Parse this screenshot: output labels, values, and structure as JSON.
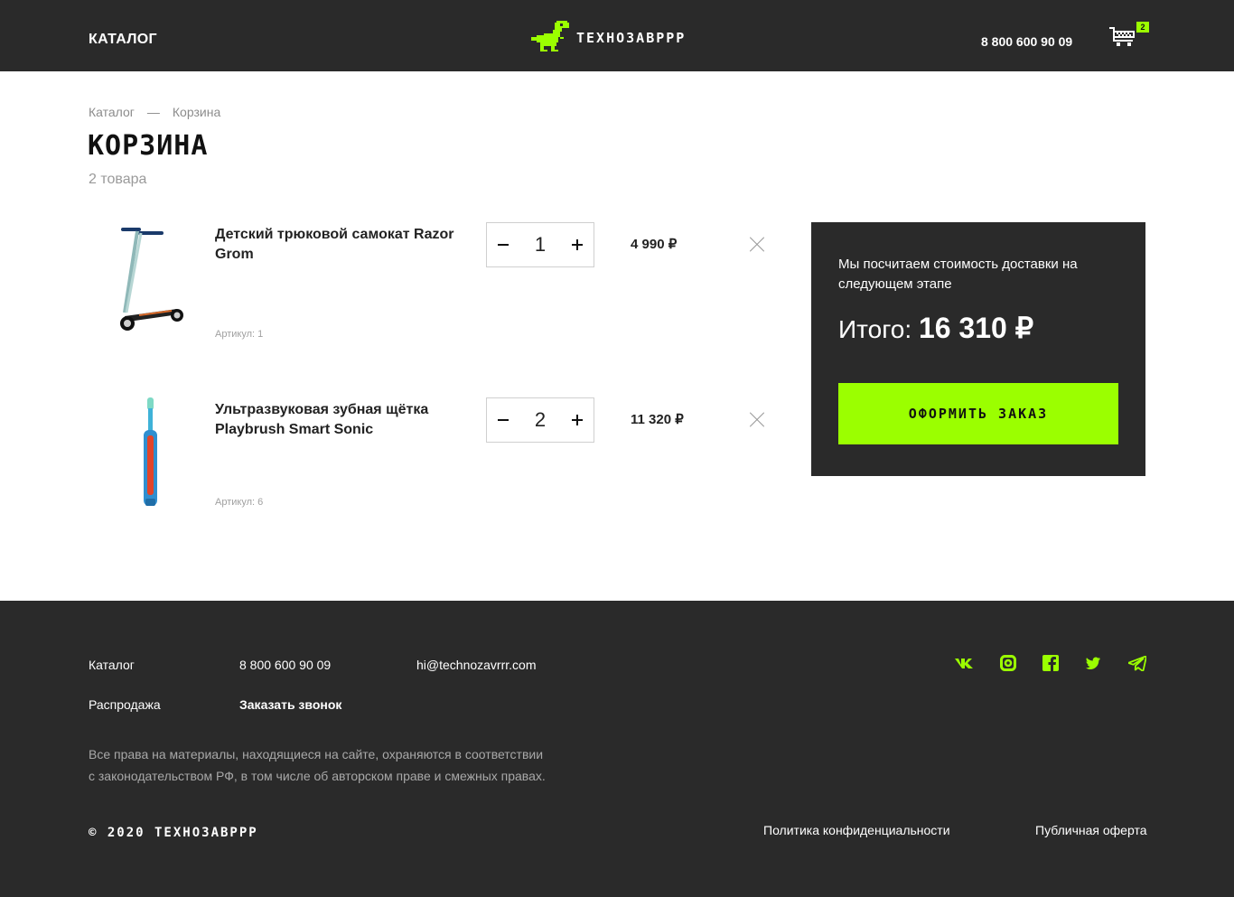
{
  "header": {
    "catalog_label": "КАТАЛОГ",
    "brand": "ТЕХНОЗАВРРР",
    "phone": "8 800 600 90 09",
    "cart_count": "2"
  },
  "breadcrumb": {
    "items": [
      "Каталог",
      "—",
      "Корзина"
    ]
  },
  "page": {
    "title": "КОРЗИНА",
    "item_count": "2 товара"
  },
  "cart": {
    "items": [
      {
        "name": "Детский трюковой самокат Razor Grom",
        "sku": "Артикул: 1",
        "quantity": "1",
        "price": "4 990 ₽"
      },
      {
        "name": "Ультразвуковая зубная щётка Playbrush Smart Sonic",
        "sku": "Артикул: 6",
        "quantity": "2",
        "price": "11 320 ₽"
      }
    ]
  },
  "summary": {
    "delivery_note": "Мы посчитаем стоимость доставки на следующем этапе",
    "total_label": "Итого:",
    "total_value": "16 310 ₽",
    "checkout_label": "ОФОРМИТЬ ЗАКАЗ"
  },
  "footer": {
    "catalog": "Каталог",
    "sale": "Распродажа",
    "phone": "8 800 600 90 09",
    "callback": "Заказать звонок",
    "email": "hi@technozavrrr.com",
    "rights_line1": "Все права на материалы, находящиеся на сайте, охраняются в соответствии",
    "rights_line2": "с законодательством РФ, в том числе об авторском праве и смежных правах.",
    "copyright": "© 2020 ТЕХНОЗАВРРР",
    "privacy": "Политика конфиденциальности",
    "offer": "Публичная оферта"
  },
  "colors": {
    "accent": "#9bff00",
    "dark": "#2a2a2a"
  },
  "icons": [
    "dino-logo-icon",
    "cart-icon",
    "minus-icon",
    "plus-icon",
    "close-icon",
    "vk-icon",
    "instagram-icon",
    "facebook-icon",
    "twitter-icon",
    "telegram-icon"
  ]
}
